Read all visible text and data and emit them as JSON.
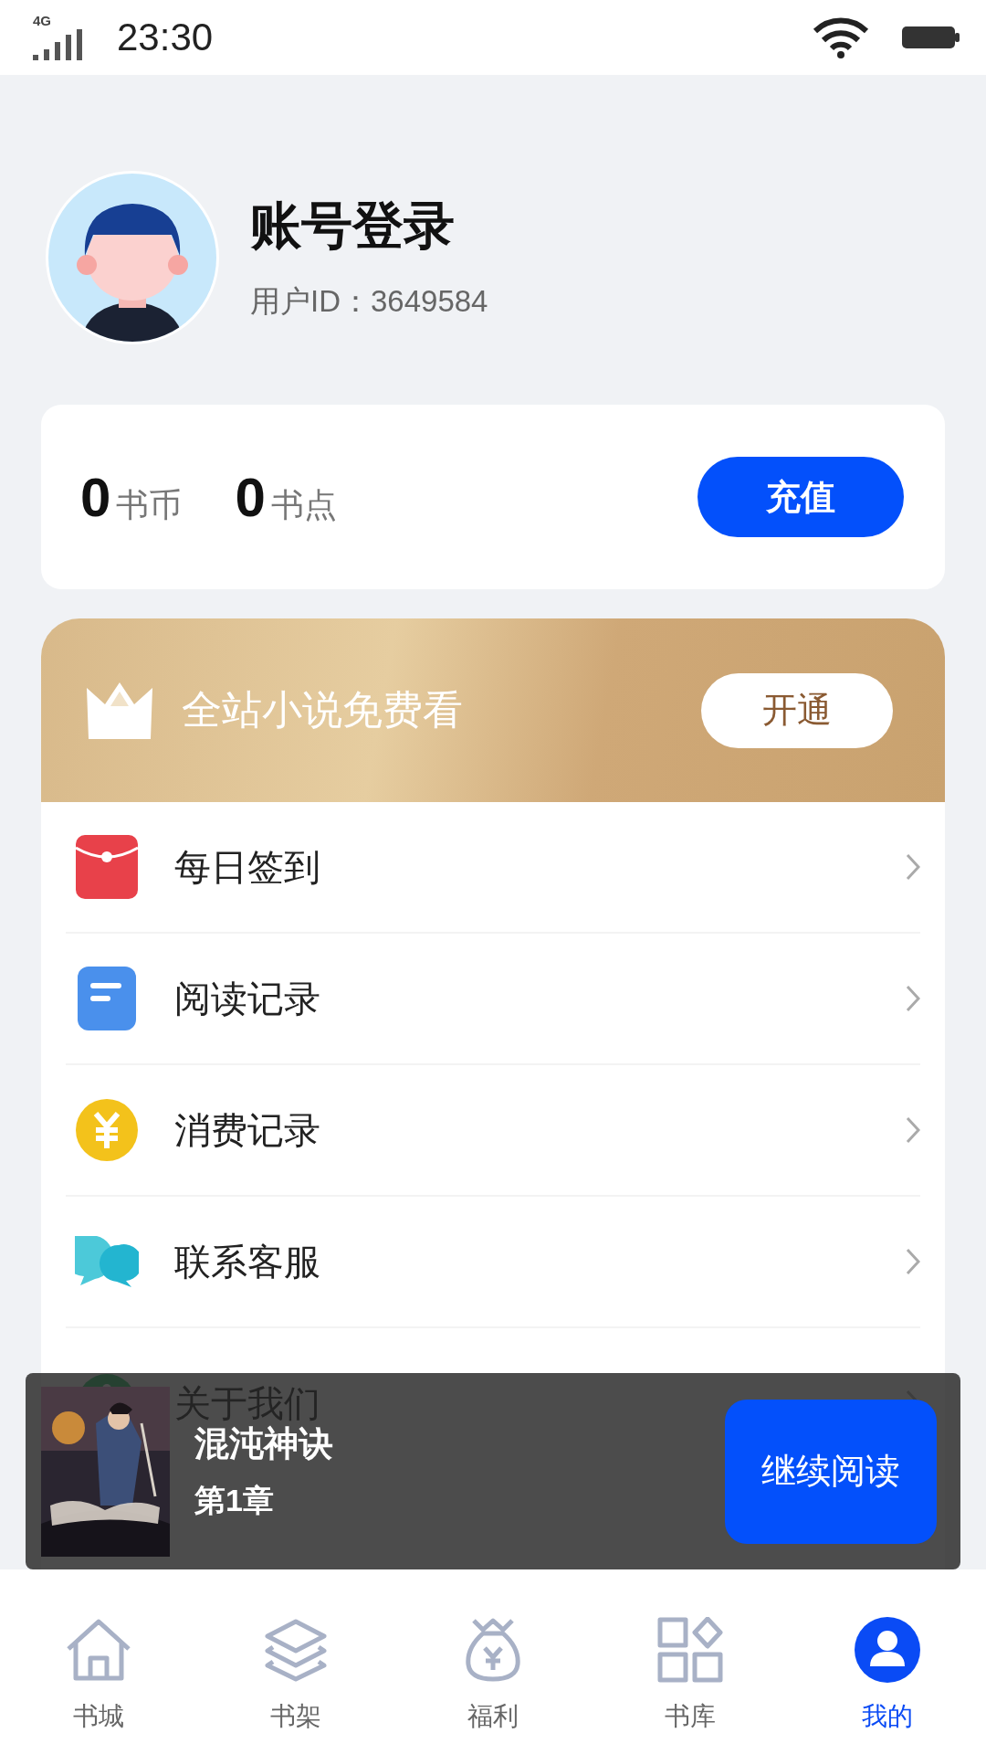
{
  "status_bar": {
    "network": "4G",
    "time": "23:30"
  },
  "profile": {
    "title": "账号登录",
    "user_id": "用户ID：3649584"
  },
  "wallet": {
    "items": [
      {
        "value": "0",
        "unit": "书币"
      },
      {
        "value": "0",
        "unit": "书点"
      }
    ],
    "button": "充值"
  },
  "vip": {
    "text": "全站小说免费看",
    "button": "开通"
  },
  "menu": [
    {
      "kind": "gift",
      "label": "每日签到"
    },
    {
      "kind": "doc",
      "label": "阅读记录"
    },
    {
      "kind": "coin",
      "label": "消费记录"
    },
    {
      "kind": "chat",
      "label": "联系客服"
    },
    {
      "kind": "info",
      "label": "关于我们"
    }
  ],
  "resume": {
    "title": "混沌神诀",
    "chapter": "第1章",
    "button": "继续阅读"
  },
  "tabs": [
    {
      "kind": "home",
      "label": "书城",
      "selected": false
    },
    {
      "kind": "layers",
      "label": "书架",
      "selected": false
    },
    {
      "kind": "bag",
      "label": "福利",
      "selected": false
    },
    {
      "kind": "grid",
      "label": "书库",
      "selected": false
    },
    {
      "kind": "user",
      "label": "我的",
      "selected": true
    }
  ]
}
